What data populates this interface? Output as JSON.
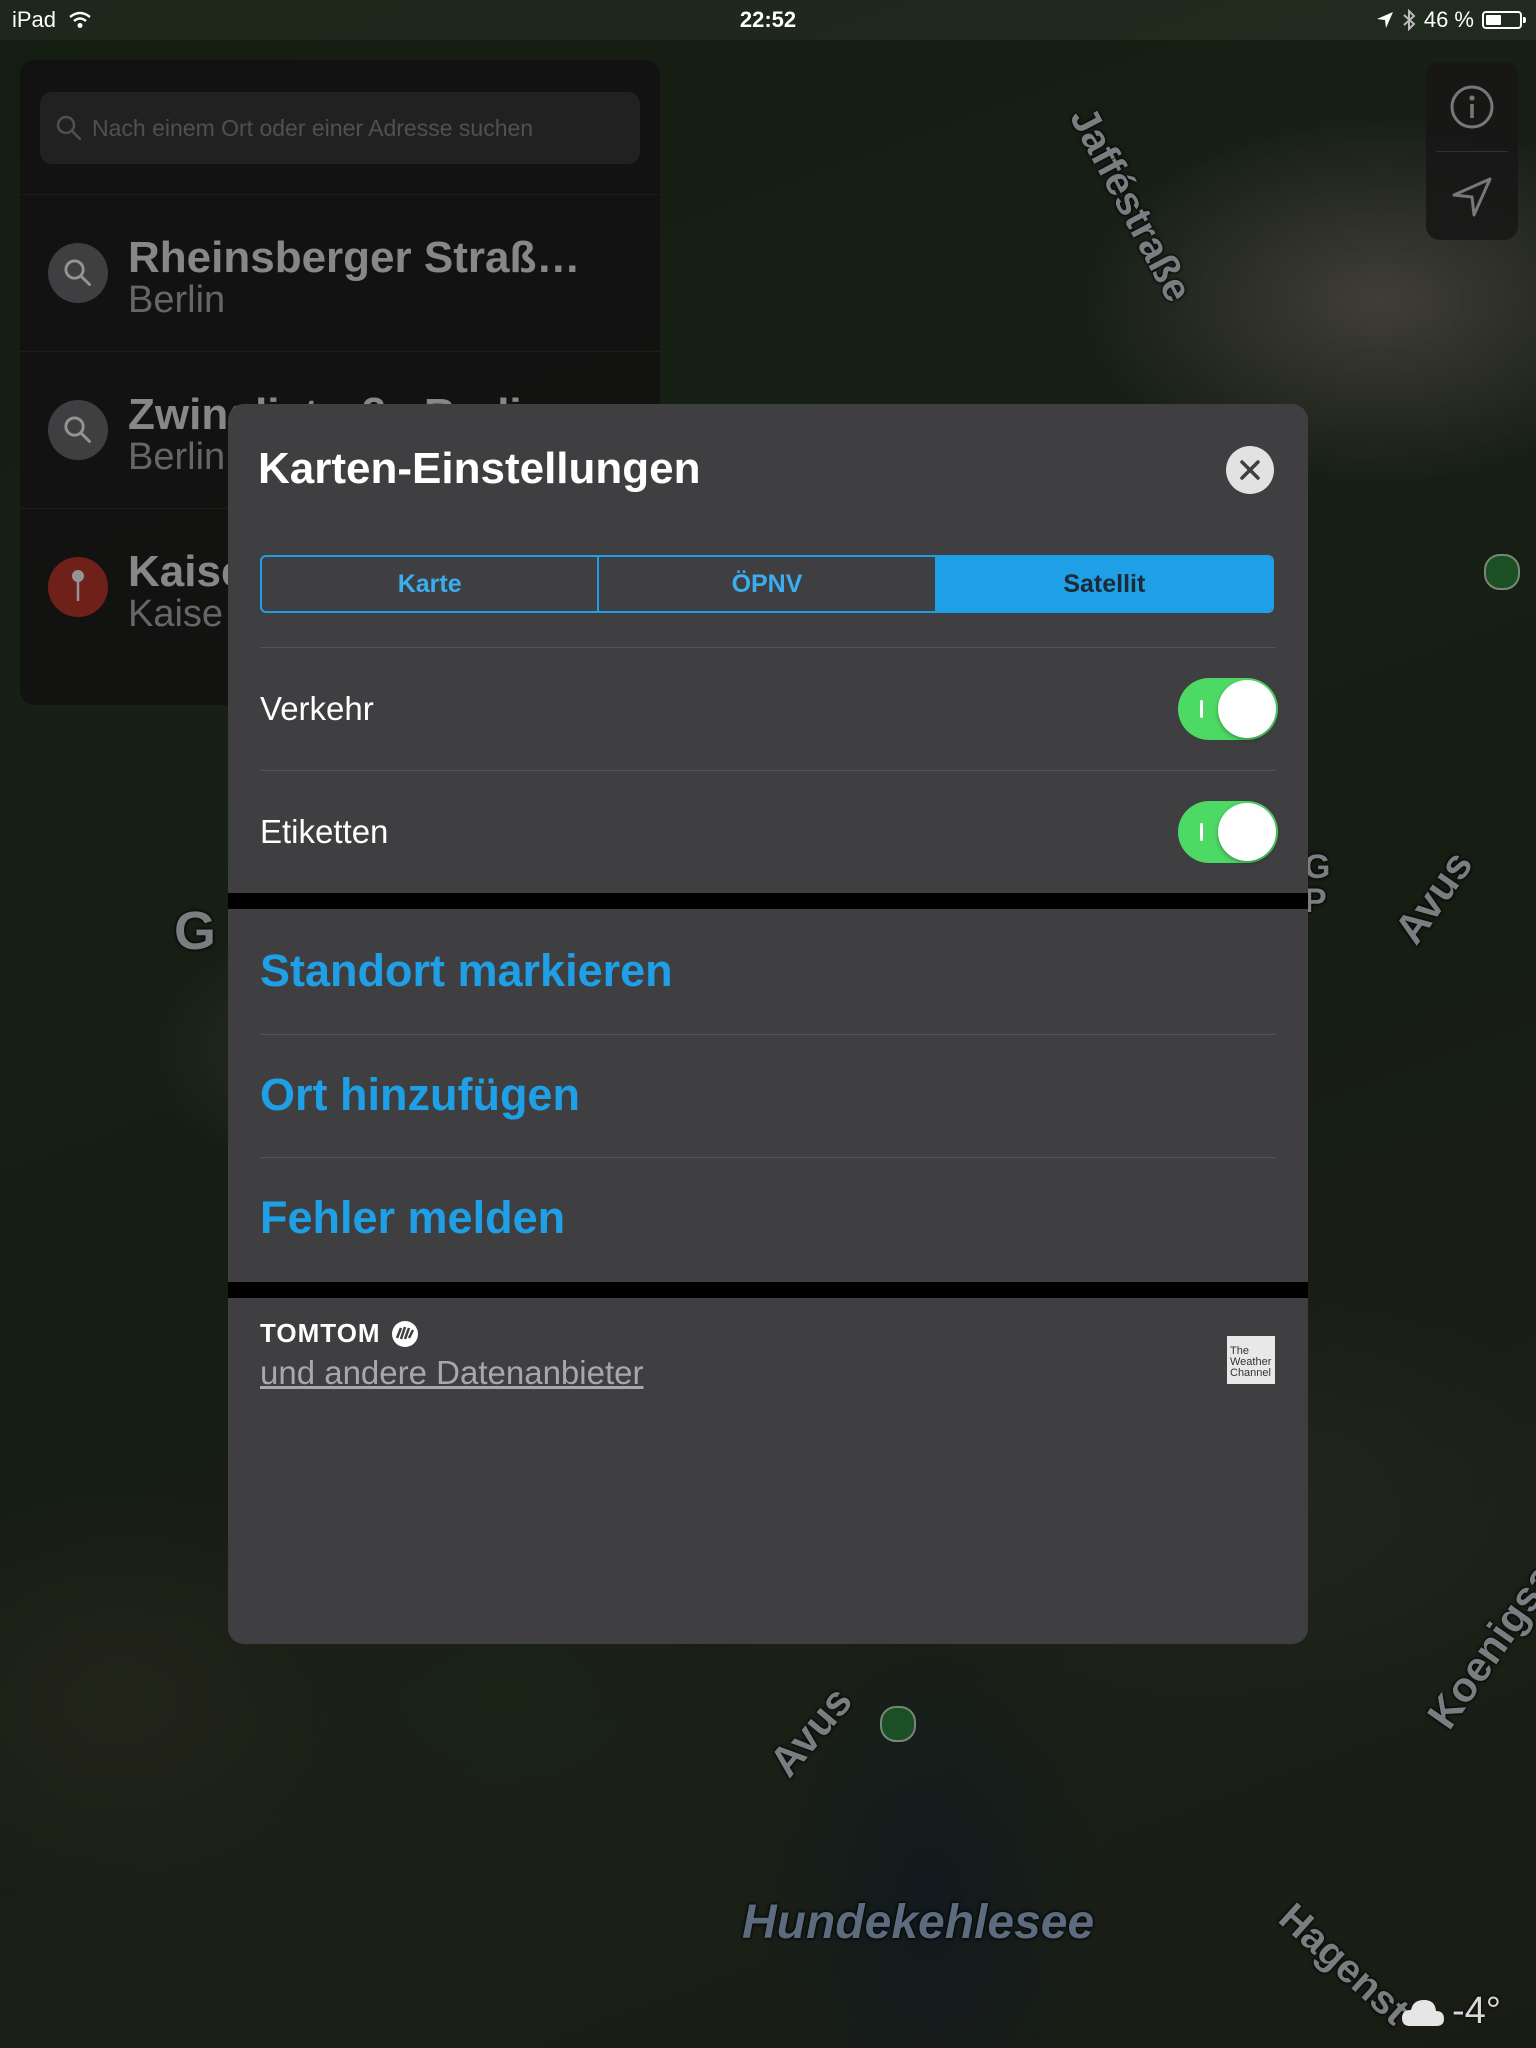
{
  "status_bar": {
    "device": "iPad",
    "time": "22:52",
    "battery": "46 %",
    "battery_level": 0.46
  },
  "map": {
    "labels": [
      "Jafféstraße",
      "Avus",
      "Avus",
      "Koenigsa",
      "Hundekehlesee",
      "Hagenst",
      "G",
      "G\nP"
    ]
  },
  "map_controls": {
    "info_icon": "info-icon",
    "location_icon": "location-arrow-icon"
  },
  "search": {
    "placeholder": "Nach einem Ort oder einer Adresse suchen",
    "recents": [
      {
        "title": "Rheinsberger Straß…",
        "subtitle": "Berlin",
        "icon": "search-icon"
      },
      {
        "title": "Zwinglistraße Berlin",
        "subtitle": "Berlin",
        "icon": "search-icon"
      },
      {
        "title": "Kaise",
        "subtitle": "Kaise",
        "icon": "pin-icon"
      }
    ]
  },
  "settings": {
    "title": "Karten-Einstellungen",
    "segments": [
      {
        "label": "Karte",
        "active": false
      },
      {
        "label": "ÖPNV",
        "active": false
      },
      {
        "label": "Satellit",
        "active": true
      }
    ],
    "toggles": [
      {
        "label": "Verkehr",
        "on": true
      },
      {
        "label": "Etiketten",
        "on": true
      }
    ],
    "actions": [
      "Standort markieren",
      "Ort hinzufügen",
      "Fehler melden"
    ],
    "attribution": {
      "provider": "TOMTOM",
      "others": "und andere Datenanbieter",
      "weather_badge": "The Weather Channel"
    }
  },
  "weather": {
    "temperature": "-4°",
    "icon": "cloud-icon"
  },
  "colors": {
    "accent": "#1fa0e6",
    "toggle_on": "#4cd964",
    "panel": "#3f3f41"
  }
}
